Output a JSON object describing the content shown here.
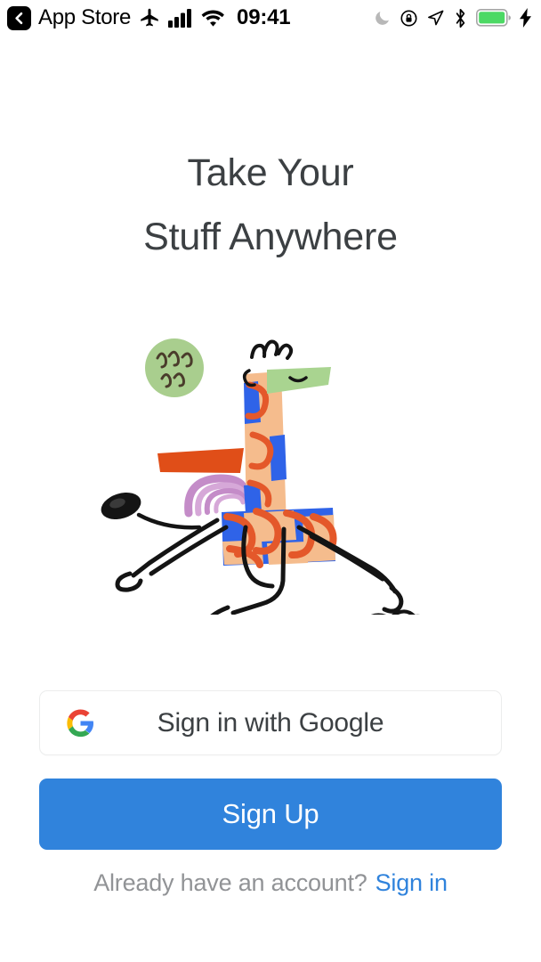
{
  "status_bar": {
    "back_label": "App Store",
    "back_icon": "chevron-left-icon",
    "airplane_icon": "airplane-mode-icon",
    "signal_icon": "cellular-signal-icon",
    "wifi_icon": "wifi-icon",
    "time": "09:41",
    "moon_icon": "do-not-disturb-moon-icon",
    "rotation_lock_icon": "rotation-lock-icon",
    "location_icon": "location-arrow-icon",
    "bluetooth_icon": "bluetooth-icon",
    "battery_icon": "battery-icon",
    "charging_icon": "charging-bolt-icon",
    "battery_color": "#4CD964",
    "signal_bars": 4
  },
  "headline": {
    "line1": "Take Your",
    "line2": "Stuff Anywhere",
    "color": "#3C4043"
  },
  "illustration": {
    "name": "running-giraffe-illustration",
    "colors": {
      "green_circle": "#A9CE8E",
      "green_snout": "#A9D490",
      "orange_bar": "#E04E18",
      "purple_arc": "#C48CC8",
      "blue_body": "#2F63E8",
      "peach_patch": "#F5BC8D",
      "orange_squiggle": "#E4582A",
      "ink": "#1A1A1A"
    }
  },
  "buttons": {
    "google": {
      "label": "Sign in with Google",
      "icon": "google-g-icon",
      "background": "#FFFFFF",
      "border_color": "#ECEDED",
      "text_color": "#3C4043"
    },
    "signup": {
      "label": "Sign Up",
      "background": "#3083DC",
      "text_color": "#FFFFFF"
    }
  },
  "footer": {
    "prompt": "Already have an account?",
    "link_label": "Sign in",
    "prompt_color": "#919396",
    "link_color": "#3083DC"
  }
}
